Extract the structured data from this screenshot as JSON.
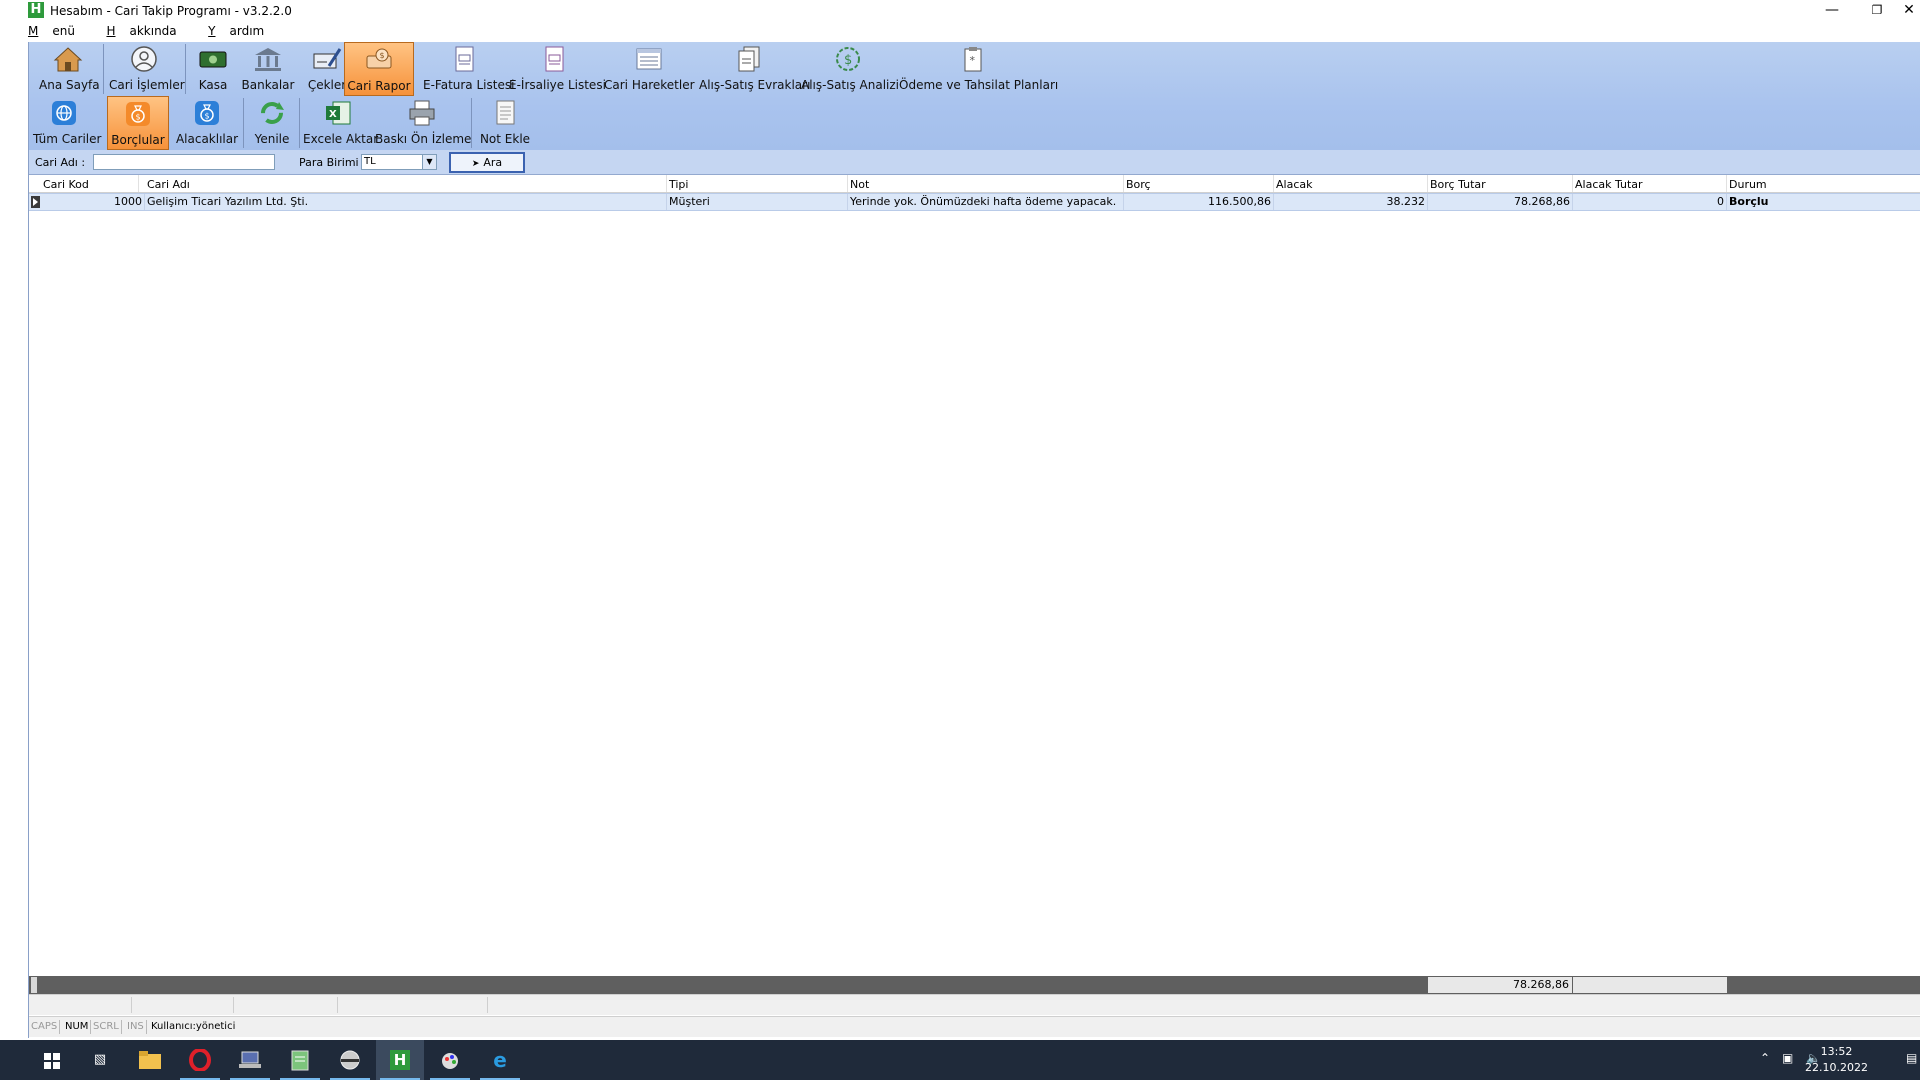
{
  "window": {
    "title": "Hesabım - Cari Takip Programı - v3.2.2.0",
    "icon_letter": "H"
  },
  "menu": [
    {
      "label": "Menü",
      "u": "M",
      "rest": "enü"
    },
    {
      "label": "Hakkında",
      "u": "H",
      "rest": "akkında"
    },
    {
      "label": "Yardım",
      "u": "Y",
      "rest": "ardım"
    }
  ],
  "toolbar_top": {
    "ana_sayfa": "Ana Sayfa",
    "cari_islemler": "Cari İşlemler",
    "kasa": "Kasa",
    "bankalar": "Bankalar",
    "cekler": "Çekler",
    "cari_rapor": "Cari Rapor",
    "efatura": "E-Fatura Listesi",
    "eirsaliye": "E-İrsaliye Listesi",
    "cari_hareketler": "Cari Hareketler",
    "alis_satis_evraklari": "Alış-Satış Evrakları",
    "alis_satis_analizi": "Alış-Satış Analizi",
    "odeme_tahsilat": "Ödeme ve Tahsilat Planları"
  },
  "toolbar_bottom": {
    "tum_cariler": "Tüm Cariler",
    "borclular": "Borçlular",
    "alacaklilar": "Alacaklılar",
    "yenile": "Yenile",
    "excel": "Excele Aktar",
    "baski": "Baskı Ön İzleme",
    "not_ekle": "Not Ekle"
  },
  "search": {
    "cari_adi_label": "Cari Adı :",
    "cari_adi_value": "",
    "para_birimi_label": "Para Birimi :",
    "para_birimi_value": "TL",
    "ara_label": "Ara"
  },
  "grid": {
    "columns": [
      "Cari Kod",
      "Cari Adı",
      "Tipi",
      "Not",
      "Borç",
      "Alacak",
      "Borç Tutar",
      "Alacak Tutar",
      "Durum"
    ],
    "rows": [
      {
        "cari_kod": "1000",
        "cari_adi": "Gelişim Ticari Yazılım Ltd. Şti.",
        "tipi": "Müşteri",
        "not": "Yerinde yok. Önümüzdeki hafta ödeme yapacak.",
        "borc": "116.500,86",
        "alacak": "38.232",
        "borc_tutar": "78.268,86",
        "alacak_tutar": "0",
        "durum": "Borçlu"
      }
    ],
    "footer_borc_tutar": "78.268,86"
  },
  "statusbar": {
    "caps": "CAPS",
    "num": "NUM",
    "scrl": "SCRL",
    "ins": "INS",
    "user": "Kullanıcı:yönetici"
  },
  "taskbar": {
    "time": "13:52",
    "date": "22.10.2022"
  }
}
